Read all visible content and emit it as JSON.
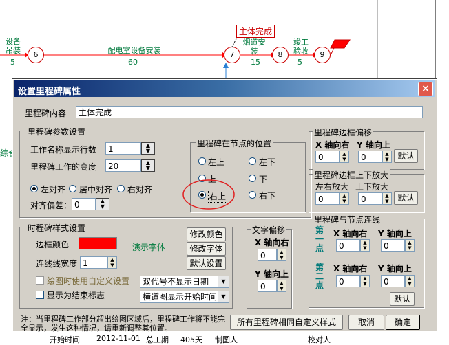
{
  "network": {
    "tasks": [
      {
        "name": "设备\n吊装",
        "duration": "5"
      },
      {
        "name": "配电室设备安装",
        "duration": "60"
      },
      {
        "name": "烟道安\n装",
        "duration": "15"
      },
      {
        "name": "竣工\n验收",
        "duration": "5"
      }
    ],
    "nodes": [
      "6",
      "7",
      "8",
      "9"
    ],
    "milestone_label": "主体完成",
    "side_text": "综合",
    "bottom_row": [
      "开始时间",
      "2012-11-01",
      "总工期",
      "405天",
      "制图人",
      "校对人"
    ]
  },
  "dialog": {
    "title": "设置里程碑属性",
    "close_symbol": "×",
    "content_label": "里程碑内容",
    "content_value": "主体完成",
    "params": {
      "title": "里程碑参数设置",
      "rows_label": "工作名称显示行数",
      "rows_value": "1",
      "height_label": "里程碑工作的高度",
      "height_value": "20",
      "align_left": "左对齐",
      "align_center": "居中对齐",
      "align_right": "右对齐",
      "offset_label": "对齐偏差：",
      "offset_value": "0"
    },
    "position": {
      "title": "里程碑在节点的位置",
      "top_left": "左上",
      "bottom_left": "左下",
      "top": "上",
      "bottom": "下",
      "top_right": "右上",
      "bottom_right": "右下",
      "selected": "右上"
    },
    "style": {
      "title": "时程碑样式设置",
      "border_color_label": "边框颜色",
      "border_color": "#ff0000",
      "demo_font": "演示字体",
      "line_width_label": "连线线宽度",
      "line_width_value": "1",
      "modify_color": "修改颜色",
      "modify_font": "修改字体",
      "default_settings": "默认设置",
      "custom_setting_label": "绘图时使用自定义设置",
      "end_marker_label": "显示为结束标志",
      "date_select": "双代号不显示日期",
      "time_select": "横道图显示开始时间"
    },
    "text_offset": {
      "title": "文字偏移",
      "x_label": "X 轴向右",
      "x_value": "0",
      "y_label": "Y 轴向上",
      "y_value": "0"
    },
    "border_offset": {
      "title": "里程碑边框偏移",
      "x_label": "X 轴向右",
      "x_value": "0",
      "y_label": "Y 轴向上",
      "y_value": "0",
      "default": "默认"
    },
    "border_zoom": {
      "title": "里程碑边框上下放大",
      "left_label": "左右放大",
      "left_value": "0",
      "up_label": "上下放大",
      "up_value": "0",
      "default": "默认"
    },
    "node_link": {
      "title": "里程碑与节点连线",
      "point1_label": "第一点",
      "point2_label": "第二点",
      "x_label": "X 轴向右",
      "y_label": "Y 轴向上",
      "p1_x": "0",
      "p1_y": "0",
      "p2_x": "0",
      "p2_y": "0",
      "default": "默认"
    },
    "note": "注：当里程碑工作部分超出绘图区域后，里程碑工作将不能完全显示，发生这种情况，请重新调整其位置。",
    "apply_all": "所有里程碑相同自定义样式",
    "cancel": "取消",
    "ok": "确定"
  }
}
